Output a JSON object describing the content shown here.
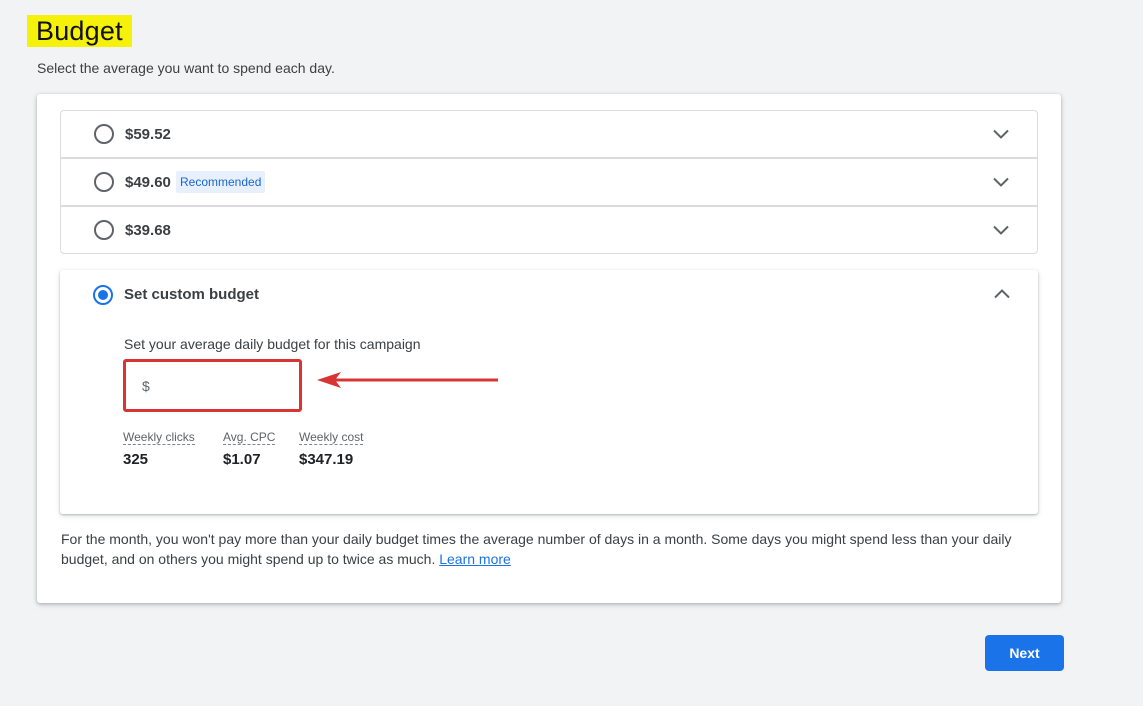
{
  "header": {
    "title": "Budget",
    "subtitle": "Select the average you want to spend each day."
  },
  "options": [
    {
      "label": "$59.52",
      "selected": false
    },
    {
      "label": "$49.60",
      "badge": "Recommended",
      "selected": false
    },
    {
      "label": "$39.68",
      "selected": false
    }
  ],
  "custom": {
    "label": "Set custom budget",
    "selected": true,
    "field_caption": "Set your average daily budget for this campaign",
    "currency_symbol": "$",
    "input_value": "",
    "stats": [
      {
        "label": "Weekly clicks",
        "value": "325"
      },
      {
        "label": "Avg. CPC",
        "value": "$1.07"
      },
      {
        "label": "Weekly cost",
        "value": "$347.19"
      }
    ]
  },
  "footnote": {
    "text": "For the month, you won't pay more than your daily budget times the average number of days in a month. Some days you might spend less than your daily budget, and on others you might spend up to twice as much.",
    "link": "Learn more"
  },
  "actions": {
    "next_label": "Next"
  },
  "colors": {
    "accent": "#1a73e8",
    "highlight": "#f5f10a",
    "annotation": "#d93434"
  }
}
